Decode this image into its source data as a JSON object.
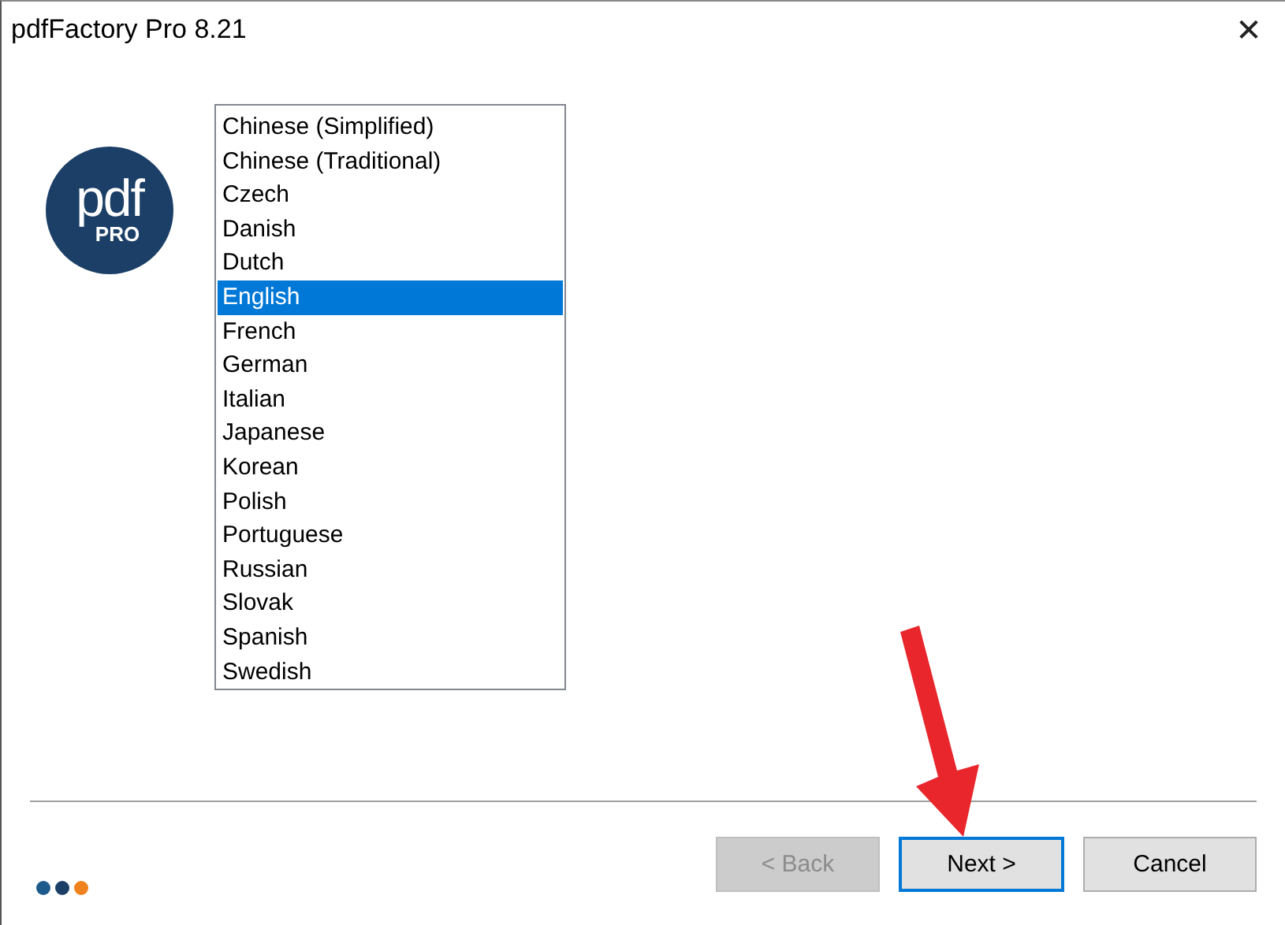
{
  "window": {
    "title": "pdfFactory Pro 8.21",
    "close": "✕"
  },
  "logo": {
    "text": "pdf",
    "subtext": "PRO"
  },
  "languages": [
    {
      "label": "Chinese (Simplified)",
      "selected": false
    },
    {
      "label": "Chinese (Traditional)",
      "selected": false
    },
    {
      "label": "Czech",
      "selected": false
    },
    {
      "label": "Danish",
      "selected": false
    },
    {
      "label": "Dutch",
      "selected": false
    },
    {
      "label": "English",
      "selected": true
    },
    {
      "label": "French",
      "selected": false
    },
    {
      "label": "German",
      "selected": false
    },
    {
      "label": "Italian",
      "selected": false
    },
    {
      "label": "Japanese",
      "selected": false
    },
    {
      "label": "Korean",
      "selected": false
    },
    {
      "label": "Polish",
      "selected": false
    },
    {
      "label": "Portuguese",
      "selected": false
    },
    {
      "label": "Russian",
      "selected": false
    },
    {
      "label": "Slovak",
      "selected": false
    },
    {
      "label": "Spanish",
      "selected": false
    },
    {
      "label": "Swedish",
      "selected": false
    }
  ],
  "steps": [
    {
      "color": "#1f5a8c"
    },
    {
      "color": "#1b3f66"
    },
    {
      "color": "#f0821e"
    }
  ],
  "buttons": [
    {
      "label": "< Back",
      "disabled": true,
      "default": false
    },
    {
      "label": "Next >",
      "disabled": false,
      "default": true
    },
    {
      "label": "Cancel",
      "disabled": false,
      "default": false
    }
  ]
}
